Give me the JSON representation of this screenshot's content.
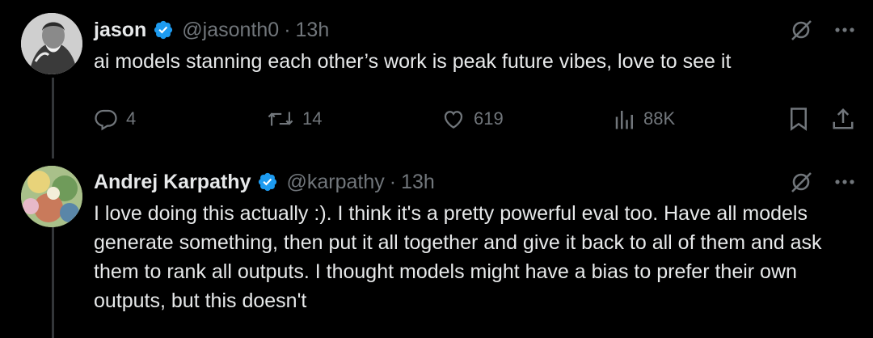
{
  "tweets": [
    {
      "name": "jason",
      "handle": "@jasonth0",
      "separator": "·",
      "time": "13h",
      "text": "ai models stanning each other’s work is peak future vibes, love to see it",
      "actions": {
        "replies": "4",
        "retweets": "14",
        "likes": "619",
        "views": "88K"
      }
    },
    {
      "name": "Andrej Karpathy",
      "handle": "@karpathy",
      "separator": "·",
      "time": "13h",
      "text": "I love doing this actually :). I think it's a pretty powerful eval too. Have all models generate something, then put it all together and give it back to all of them and ask them to rank all outputs. I thought models might have a bias to prefer their own outputs, but this doesn't"
    }
  ],
  "colors": {
    "background": "#000000",
    "text": "#e7e9ea",
    "muted": "#71767b",
    "verified": "#1d9bf0"
  },
  "icons": [
    "grok-icon",
    "more-icon",
    "verified-badge-icon",
    "reply-icon",
    "retweet-icon",
    "like-icon",
    "views-icon",
    "bookmark-icon",
    "share-icon"
  ]
}
